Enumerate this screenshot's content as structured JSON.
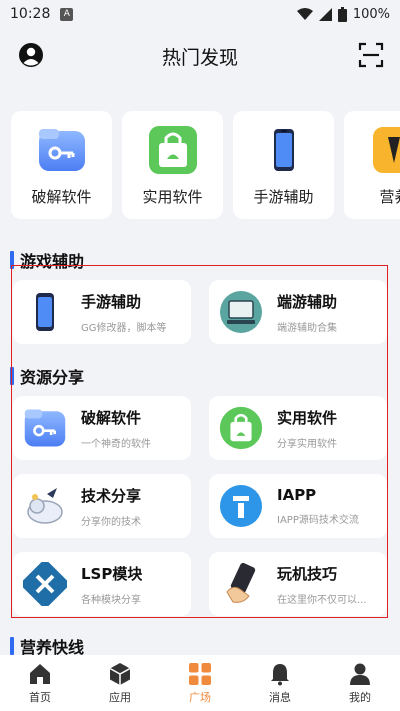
{
  "status": {
    "time": "10:28",
    "badge": "A",
    "battery": "100%"
  },
  "header": {
    "title": "热门发现"
  },
  "categories": [
    {
      "label": "破解软件",
      "icon": "key-folder-icon"
    },
    {
      "label": "实用软件",
      "icon": "shopping-bag-icon"
    },
    {
      "label": "手游辅助",
      "icon": "phone-icon"
    },
    {
      "label": "营养",
      "icon": "book-icon"
    }
  ],
  "sections": {
    "game": "游戏辅助",
    "resource": "资源分享",
    "nutrition": "营养快线"
  },
  "game_cards": [
    {
      "title": "手游辅助",
      "subtitle": "GG修改器，脚本等"
    },
    {
      "title": "端游辅助",
      "subtitle": "端游辅助合集"
    }
  ],
  "resource_cards": [
    {
      "title": "破解软件",
      "subtitle": "一个神奇的软件"
    },
    {
      "title": "实用软件",
      "subtitle": "分享实用软件"
    },
    {
      "title": "技术分享",
      "subtitle": "分享你的技术"
    },
    {
      "title": "IAPP",
      "subtitle": "IAPP源码技术交流"
    },
    {
      "title": "LSP模块",
      "subtitle": "各种模块分享"
    },
    {
      "title": "玩机技巧",
      "subtitle": "在这里你不仅可以..."
    }
  ],
  "nav": [
    {
      "label": "首页"
    },
    {
      "label": "应用"
    },
    {
      "label": "广场"
    },
    {
      "label": "消息"
    },
    {
      "label": "我的"
    }
  ],
  "colors": {
    "accent": "#f08a3c",
    "section_bar": "#2f6bf0",
    "highlight_border": "#e02020"
  }
}
